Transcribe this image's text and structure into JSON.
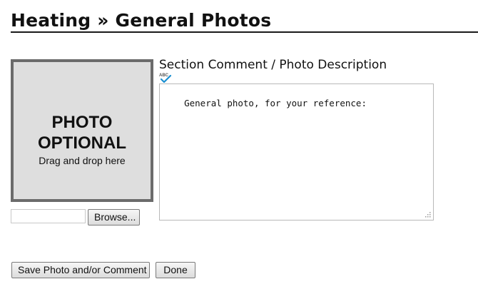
{
  "header": {
    "title": "Heating » General Photos"
  },
  "photo": {
    "main_label_line1": "PHOTO",
    "main_label_line2": "OPTIONAL",
    "hint": "Drag and drop here"
  },
  "upload": {
    "file_value": "",
    "browse_label": "Browse..."
  },
  "comment": {
    "label": "Section Comment / Photo Description",
    "value": "General photo, for your reference:"
  },
  "actions": {
    "save_label": "Save Photo and/or Comment",
    "done_label": "Done"
  },
  "icons": {
    "spellcheck": "spellcheck-icon",
    "resize": "resize-grip-icon"
  },
  "colors": {
    "photo_bg": "#dedede",
    "photo_border": "#6b6b6b",
    "spell_check": "#1a8fd1"
  }
}
